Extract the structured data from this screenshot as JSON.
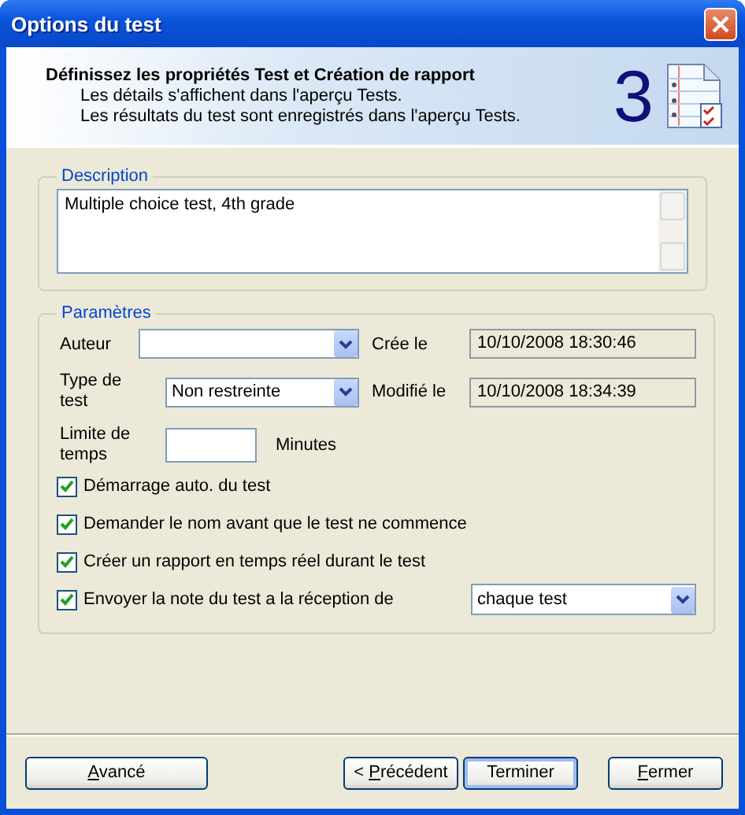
{
  "window": {
    "title": "Options du test"
  },
  "header": {
    "title": "Définissez les propriétés Test et Création de rapport",
    "lines": [
      "Les détails s'affichent dans l'aperçu Tests.",
      "Les résultats du test sont enregistrés dans l'aperçu Tests."
    ],
    "step": "3"
  },
  "description": {
    "legend": "Description",
    "value": "Multiple choice test, 4th grade"
  },
  "parameters": {
    "legend": "Paramètres",
    "author": {
      "label": "Auteur"
    },
    "created": {
      "label": "Crée le",
      "value": "10/10/2008 18:30:46"
    },
    "test_type": {
      "label": "Type de test",
      "value": "Non restreinte"
    },
    "modified": {
      "label": "Modifié le",
      "value": "10/10/2008 18:34:39"
    },
    "time_limit": {
      "label": "Limite de temps",
      "unit": "Minutes"
    },
    "options": [
      {
        "label": "Démarrage auto. du test",
        "checked": true
      },
      {
        "label": "Demander le nom avant que le test ne commence",
        "checked": true
      },
      {
        "label": "Créer un rapport en temps réel durant le test",
        "checked": true
      },
      {
        "label": "Envoyer la note du test a la réception de",
        "checked": true,
        "select": "chaque test"
      }
    ]
  },
  "buttons": [
    {
      "key": "A",
      "after": "vancé",
      "default": false
    },
    {
      "before": "< ",
      "key": "P",
      "after": "récédent",
      "default": false
    },
    {
      "before": "Terminer",
      "default": true
    },
    {
      "key": "F",
      "after": "ermer",
      "default": false
    }
  ]
}
